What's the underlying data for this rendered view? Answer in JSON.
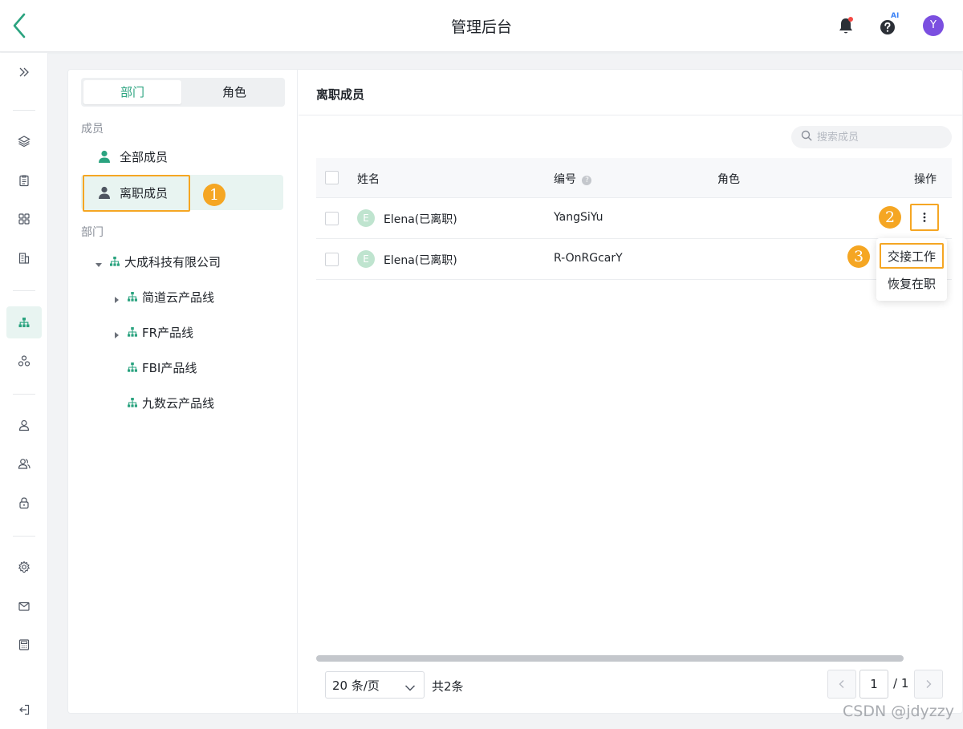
{
  "header": {
    "title": "管理后台",
    "help_badge": "AI",
    "avatar_initial": "Y"
  },
  "rail": {
    "icons": [
      "expand-icon",
      "layers-icon",
      "clipboard-icon",
      "grid-icon",
      "building-icon",
      "org-chart-icon",
      "connections-icon",
      "user-icon",
      "users-icon",
      "lock-icon",
      "settings-icon",
      "mail-icon",
      "calculator-icon",
      "logout-icon"
    ],
    "active": "org-chart-icon"
  },
  "left": {
    "tabs": [
      "部门",
      "角色"
    ],
    "members_label": "成员",
    "members": [
      {
        "label": "全部成员",
        "selected": false
      },
      {
        "label": "离职成员",
        "selected": true
      }
    ],
    "dept_label": "部门",
    "tree": [
      {
        "label": "大成科技有限公司",
        "level": 0,
        "expanded": true
      },
      {
        "label": "简道云产品线",
        "level": 1,
        "expandable": true
      },
      {
        "label": "FR产品线",
        "level": 1,
        "expandable": true
      },
      {
        "label": "FBI产品线",
        "level": 1,
        "expandable": false
      },
      {
        "label": "九数云产品线",
        "level": 1,
        "expandable": false
      }
    ]
  },
  "right": {
    "title": "离职成员",
    "search_placeholder": "搜索成员",
    "columns": [
      "姓名",
      "编号",
      "角色",
      "操作"
    ],
    "rows": [
      {
        "avatar": "E",
        "name": "Elena(已离职)",
        "id": "YangSiYu",
        "role": ""
      },
      {
        "avatar": "E",
        "name": "Elena(已离职)",
        "id": "R-OnRGcarY",
        "role": ""
      }
    ],
    "menu": [
      "交接工作",
      "恢复在职"
    ],
    "page_size": "20 条/页",
    "total": "共2条",
    "page_current": "1",
    "page_total": "/ 1"
  },
  "annotations": {
    "step1": "1",
    "step2": "2",
    "step3": "3",
    "color": "#f5a623"
  },
  "watermark": "CSDN @jdyzzy",
  "colors": {
    "accent": "#2aa37f",
    "selected_bg": "#e8f4f1",
    "avatar": "#7b4fe0"
  }
}
